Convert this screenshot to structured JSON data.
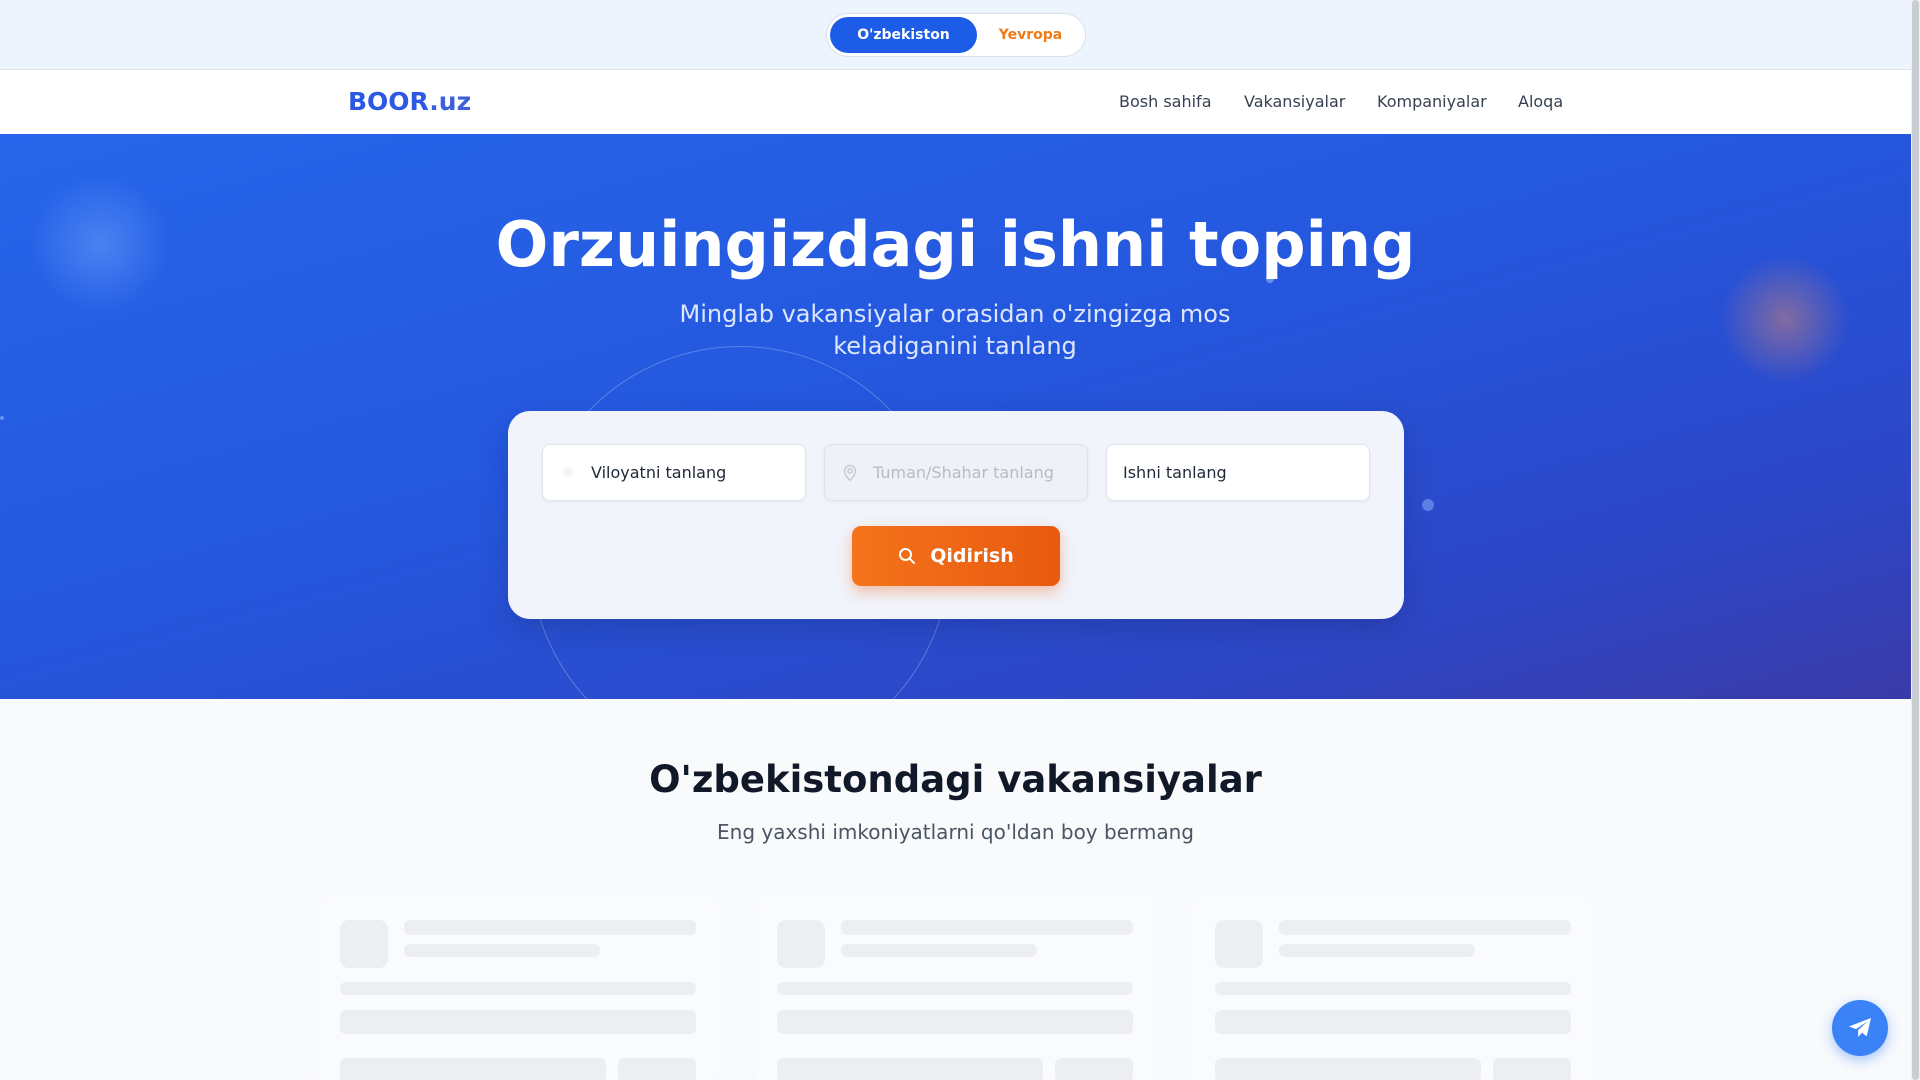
{
  "region_switch": {
    "active": "O'zbekiston",
    "inactive": "Yevropa"
  },
  "navbar": {
    "logo_main": "BOOR",
    "logo_tld": ".uz",
    "links": [
      "Bosh sahifa",
      "Vakansiyalar",
      "Kompaniyalar",
      "Aloqa"
    ]
  },
  "hero": {
    "title": "Orzuingizdagi ishni toping",
    "subtitle": "Minglab vakansiyalar orasidan o'zingizga mos keladiganini tanlang"
  },
  "search": {
    "region_value": "Viloyatni tanlang",
    "district_placeholder": "Tuman/Shahar tanlang",
    "job_value": "Ishni tanlang",
    "button_label": "Qidirish"
  },
  "section": {
    "title": "O'zbekistondagi vakansiyalar",
    "subtitle": "Eng yaxshi imkoniyatlarni qo'ldan boy bermang"
  },
  "colors": {
    "primary": "#1d5ce6",
    "accent": "#f07a18",
    "telegram": "#3b82f6"
  },
  "icons": {
    "search_button": "search-icon",
    "district_field": "map-pin-icon",
    "floating": "telegram-icon"
  }
}
